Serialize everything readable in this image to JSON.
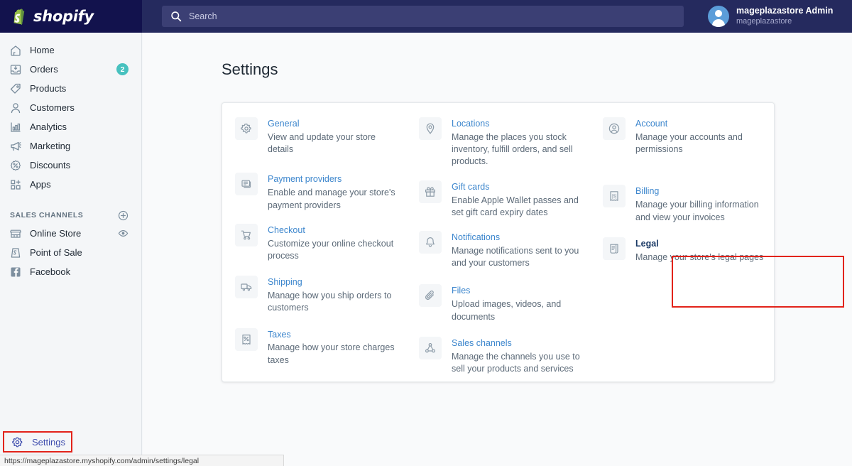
{
  "topbar": {
    "brand": "shopify",
    "brand_icon": "shopify-bag-logo",
    "search": {
      "icon": "search-icon",
      "placeholder": "Search",
      "value": ""
    },
    "user": {
      "name": "mageplazastore Admin",
      "store": "mageplazastore",
      "avatar_icon": "user-avatar-icon"
    }
  },
  "sidebar": {
    "items": [
      {
        "label": "Home",
        "icon": "home-icon",
        "badge": ""
      },
      {
        "label": "Orders",
        "icon": "orders-inbox-icon",
        "badge": "2"
      },
      {
        "label": "Products",
        "icon": "products-tag-icon",
        "badge": ""
      },
      {
        "label": "Customers",
        "icon": "customers-person-icon",
        "badge": ""
      },
      {
        "label": "Analytics",
        "icon": "analytics-bars-icon",
        "badge": ""
      },
      {
        "label": "Marketing",
        "icon": "marketing-megaphone-icon",
        "badge": ""
      },
      {
        "label": "Discounts",
        "icon": "discounts-percent-icon",
        "badge": ""
      },
      {
        "label": "Apps",
        "icon": "apps-grid-plus-icon",
        "badge": ""
      }
    ],
    "section": {
      "title": "SALES CHANNELS",
      "add_icon": "plus-circle-icon"
    },
    "channels": [
      {
        "label": "Online Store",
        "icon": "online-store-icon",
        "trailing_icon": "eye-icon"
      },
      {
        "label": "Point of Sale",
        "icon": "point-of-sale-icon",
        "trailing_icon": ""
      },
      {
        "label": "Facebook",
        "icon": "facebook-icon",
        "trailing_icon": ""
      }
    ],
    "settings": {
      "label": "Settings",
      "icon": "gear-icon",
      "highlighted": true
    }
  },
  "main": {
    "page_title": "Settings",
    "columns": [
      {
        "items": [
          {
            "title": "General",
            "desc": "View and update your store details",
            "icon": "gear-icon"
          },
          {
            "title": "Payment providers",
            "desc": "Enable and manage your store's payment providers",
            "icon": "payment-card-icon"
          },
          {
            "title": "Checkout",
            "desc": "Customize your online checkout process",
            "icon": "cart-icon"
          },
          {
            "title": "Shipping",
            "desc": "Manage how you ship orders to customers",
            "icon": "truck-icon"
          },
          {
            "title": "Taxes",
            "desc": "Manage how your store charges taxes",
            "icon": "tax-receipt-icon"
          }
        ]
      },
      {
        "items": [
          {
            "title": "Locations",
            "desc": "Manage the places you stock inventory, fulfill orders, and sell products.",
            "icon": "location-pin-icon"
          },
          {
            "title": "Gift cards",
            "desc": "Enable Apple Wallet passes and set gift card expiry dates",
            "icon": "gift-icon"
          },
          {
            "title": "Notifications",
            "desc": "Manage notifications sent to you and your customers",
            "icon": "bell-icon"
          },
          {
            "title": "Files",
            "desc": "Upload images, videos, and documents",
            "icon": "paperclip-icon"
          },
          {
            "title": "Sales channels",
            "desc": "Manage the channels you use to sell your products and services",
            "icon": "sales-channels-node-icon"
          }
        ]
      },
      {
        "items": [
          {
            "title": "Account",
            "desc": "Manage your accounts and permissions",
            "icon": "account-circle-icon"
          },
          {
            "title": "Billing",
            "desc": "Manage your billing information and view your invoices",
            "icon": "billing-receipt-icon"
          },
          {
            "title": "Legal",
            "desc": "Manage your store's legal pages",
            "icon": "legal-scroll-icon",
            "highlighted": true
          }
        ]
      }
    ]
  },
  "statusbar": {
    "url": "https://mageplazastore.myshopify.com/admin/settings/legal"
  },
  "colors": {
    "topbar": "#252a5e",
    "logo_zone": "#12124d",
    "link_blue": "#3c86cd",
    "badge_teal": "#47c1bf",
    "highlight_red": "#e2231a",
    "sidebar_bg": "#f4f6f8",
    "main_bg": "#f9fafb"
  }
}
